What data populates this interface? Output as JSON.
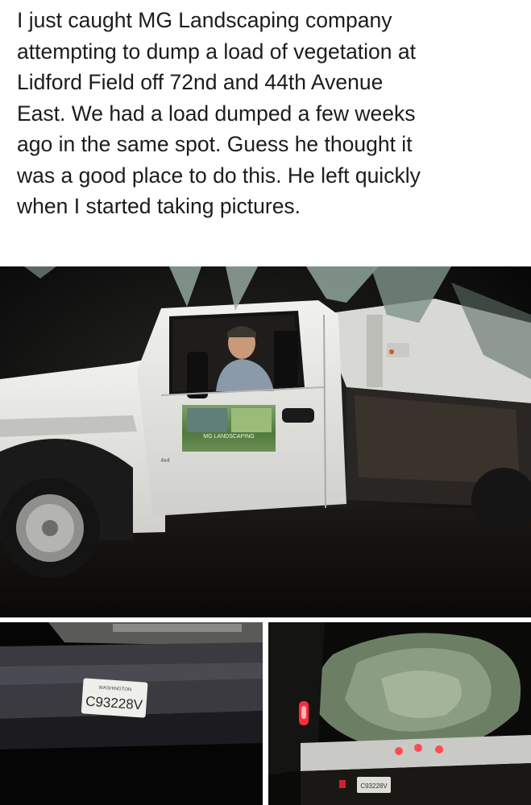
{
  "post": {
    "lines": [
      "I just caught MG Landscaping company",
      "attempting to dump a load of vegetation at",
      "Lidford Field off 72nd and 44th Avenue",
      "East. We had a load dumped a few weeks",
      "ago in the same spot. Guess he thought it",
      "was a good place to do this. He left quickly",
      "when I started taking pictures."
    ]
  },
  "photos": {
    "main": {
      "door_sign_text": "MG LANDSCAPING",
      "badge_text": "4x4"
    },
    "plate_closeup": {
      "state": "WASHINGTON",
      "plate_number": "C93228V"
    },
    "rear_view": {
      "plate_number": "C93228V"
    }
  },
  "colors": {
    "truck_white": "#e9e9e6",
    "night": "#0b0b0b",
    "foliage": "#8fa59a",
    "tail_light": "#ff2a3c"
  }
}
